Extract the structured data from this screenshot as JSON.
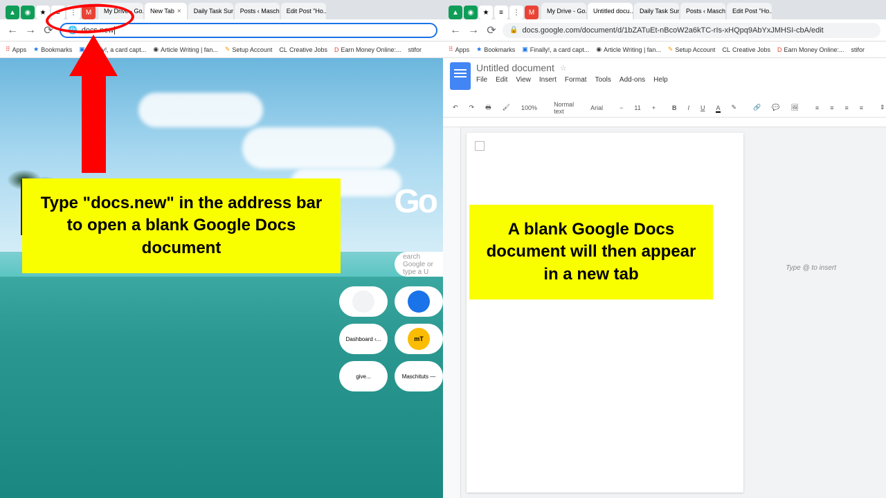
{
  "left": {
    "tabs": [
      {
        "label": "My Drive - Go..."
      },
      {
        "label": "New Tab",
        "active": true
      },
      {
        "label": "Daily Task Sun..."
      },
      {
        "label": "Posts ‹ Maschi..."
      },
      {
        "label": "Edit Post \"Ho..."
      }
    ],
    "address": "docs.new",
    "bookmarks": [
      {
        "label": "Apps"
      },
      {
        "label": "Bookmarks"
      },
      {
        "label": "Finally!, a card capt..."
      },
      {
        "label": "Article Writing | fan..."
      },
      {
        "label": "Setup Account"
      },
      {
        "label": "Creative Jobs"
      },
      {
        "label": "Earn Money Online:..."
      },
      {
        "label": "stifor"
      }
    ],
    "google_logo": "Go",
    "search_placeholder": "earch Google or type a U",
    "shortcuts": [
      "Dashboard ‹...",
      "give...",
      "Maschituts —"
    ],
    "callout": "Type \"docs.new\" in the address bar to open a blank Google Docs document"
  },
  "right": {
    "tabs": [
      {
        "label": "My Drive - Go..."
      },
      {
        "label": "Untitled docu...",
        "active": true
      },
      {
        "label": "Daily Task Sun..."
      },
      {
        "label": "Posts ‹ Maschi..."
      },
      {
        "label": "Edit Post \"Ho..."
      }
    ],
    "address": "docs.google.com/document/d/1bZATuEt-nBcoW2a6kTC-rIs-xHQpq9AbYxJMHSI-cbA/edit",
    "bookmarks": [
      {
        "label": "Apps"
      },
      {
        "label": "Bookmarks"
      },
      {
        "label": "Finally!, a card capt..."
      },
      {
        "label": "Article Writing | fan..."
      },
      {
        "label": "Setup Account"
      },
      {
        "label": "Creative Jobs"
      },
      {
        "label": "Earn Money Online:..."
      },
      {
        "label": "stifor"
      }
    ],
    "doc_title": "Untitled document",
    "menus": [
      "File",
      "Edit",
      "View",
      "Insert",
      "Format",
      "Tools",
      "Add-ons",
      "Help"
    ],
    "toolbar": {
      "zoom": "100%",
      "style": "Normal text",
      "font": "Arial",
      "size": "11"
    },
    "type_hint": "Type @ to insert",
    "callout": "A blank Google Docs document will then appear in a new tab"
  }
}
